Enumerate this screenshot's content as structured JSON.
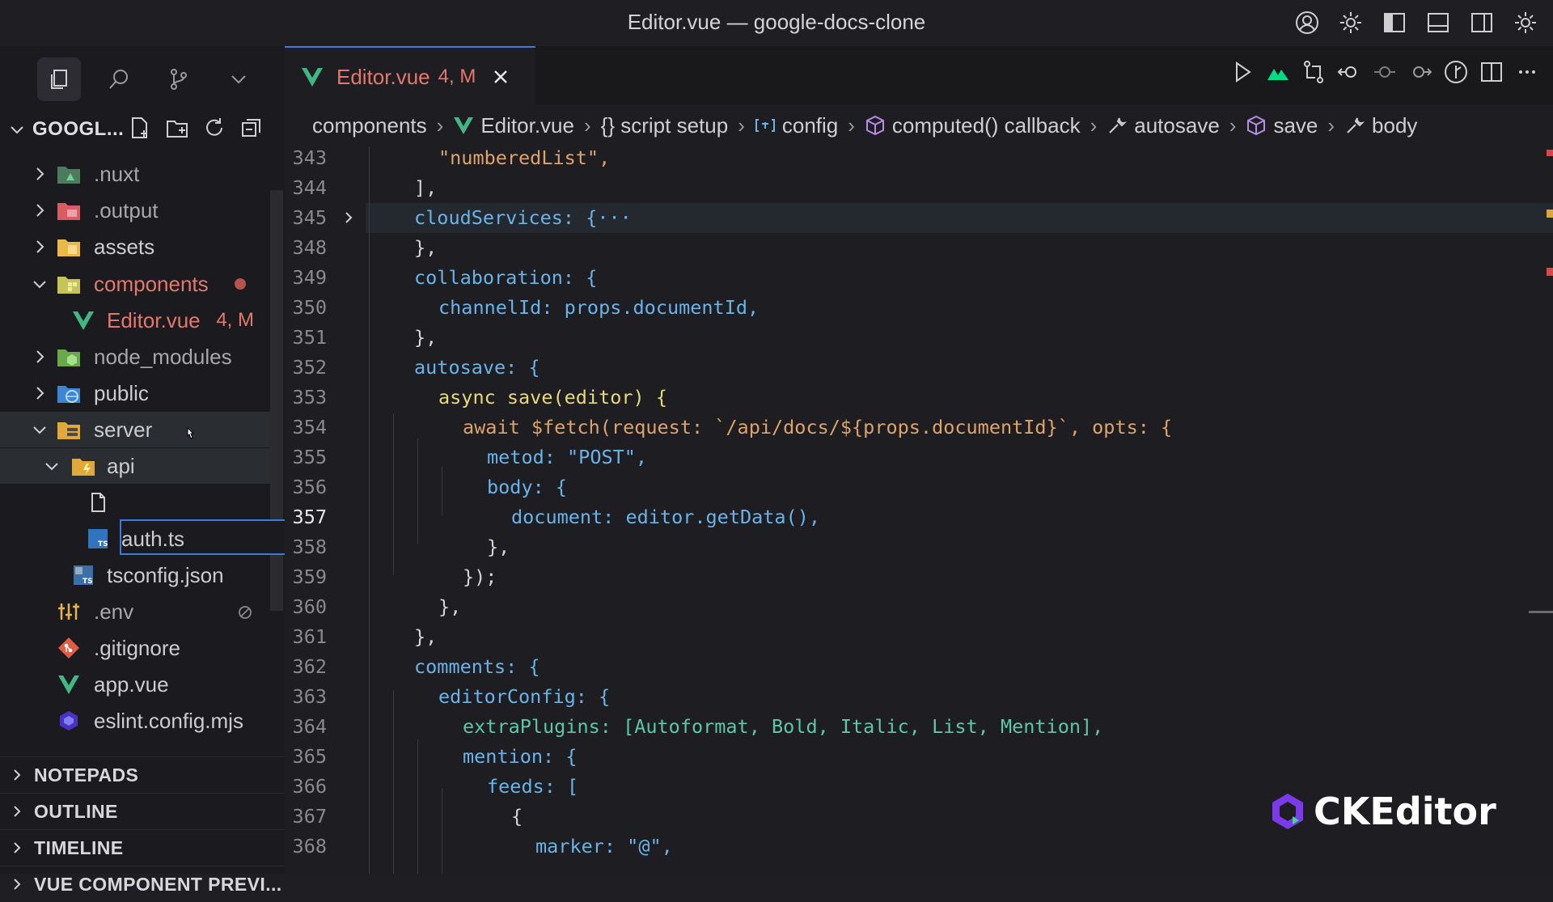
{
  "window": {
    "title": "Editor.vue — google-docs-clone",
    "titlebar_icons": [
      "account-icon",
      "settings-icon",
      "toggle-primary-sidebar-icon",
      "toggle-panel-icon",
      "toggle-secondary-sidebar-icon",
      "customize-layout-icon"
    ]
  },
  "sidebar": {
    "explorer_title": "GOOGL...",
    "tree": [
      {
        "label": ".nuxt",
        "type": "folder",
        "expanded": false
      },
      {
        "label": ".output",
        "type": "folder",
        "expanded": false
      },
      {
        "label": "assets",
        "type": "folder",
        "expanded": false
      },
      {
        "label": "components",
        "type": "folder",
        "expanded": true,
        "modified": true
      },
      {
        "label": "Editor.vue",
        "type": "vue",
        "badge": "4, M"
      },
      {
        "label": "node_modules",
        "type": "folder",
        "expanded": false
      },
      {
        "label": "public",
        "type": "folder",
        "expanded": false
      },
      {
        "label": "server",
        "type": "folder",
        "expanded": true
      },
      {
        "label": "api",
        "type": "folder",
        "expanded": true
      },
      {
        "label": "",
        "type": "new-file-input"
      },
      {
        "label": "auth.ts",
        "type": "ts"
      },
      {
        "label": "tsconfig.json",
        "type": "tsconfig"
      },
      {
        "label": ".env",
        "type": "env"
      },
      {
        "label": ".gitignore",
        "type": "git"
      },
      {
        "label": "app.vue",
        "type": "vue"
      },
      {
        "label": "eslint.config.mjs",
        "type": "eslint"
      }
    ],
    "sections": [
      "NOTEPADS",
      "OUTLINE",
      "TIMELINE",
      "VUE COMPONENT PREVI..."
    ]
  },
  "editor": {
    "tab": {
      "label": "Editor.vue",
      "badge": "4, M"
    },
    "breadcrumb": [
      "components",
      "Editor.vue",
      "{} script setup",
      "config",
      "computed() callback",
      "autosave",
      "save",
      "body"
    ],
    "current_line": 357,
    "lines": [
      {
        "n": 343,
        "text": "\"numberedList\","
      },
      {
        "n": 344,
        "text": "],"
      },
      {
        "n": 345,
        "text": "cloudServices: {···"
      },
      {
        "n": 348,
        "text": "},"
      },
      {
        "n": 349,
        "text": "collaboration: {"
      },
      {
        "n": 350,
        "text": "channelId: props.documentId,"
      },
      {
        "n": 351,
        "text": "},"
      },
      {
        "n": 352,
        "text": "autosave: {"
      },
      {
        "n": 353,
        "text": "async save(editor) {"
      },
      {
        "n": 354,
        "text": "await $fetch(request: `/api/docs/${props.documentId}`, opts: {"
      },
      {
        "n": 355,
        "text": "metod: \"POST\","
      },
      {
        "n": 356,
        "text": "body: {"
      },
      {
        "n": 357,
        "text": "document: editor.getData(),"
      },
      {
        "n": 358,
        "text": "},"
      },
      {
        "n": 359,
        "text": "});"
      },
      {
        "n": 360,
        "text": "},"
      },
      {
        "n": 361,
        "text": "},"
      },
      {
        "n": 362,
        "text": "comments: {"
      },
      {
        "n": 363,
        "text": "editorConfig: {"
      },
      {
        "n": 364,
        "text": "extraPlugins: [Autoformat, Bold, Italic, List, Mention],"
      },
      {
        "n": 365,
        "text": "mention: {"
      },
      {
        "n": 366,
        "text": "feeds: ["
      },
      {
        "n": 367,
        "text": "{"
      },
      {
        "n": 368,
        "text": "marker: \"@\","
      }
    ]
  },
  "watermark": {
    "text": "CKEditor"
  },
  "colors": {
    "accent": "#3a7be0",
    "modified": "#e3786c",
    "vue_green": "#41b883"
  }
}
